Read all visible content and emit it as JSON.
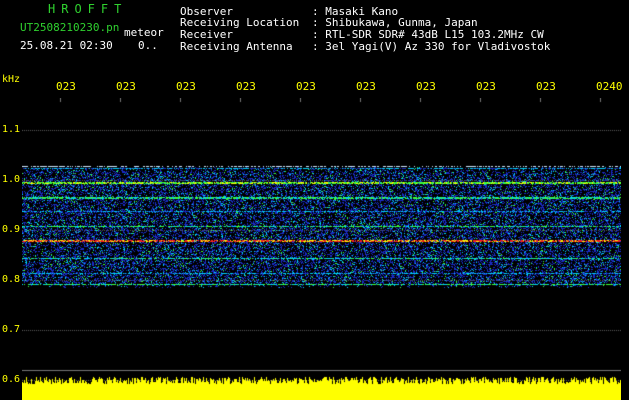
{
  "header": {
    "brand": "HROFFT",
    "filename": "UT2508210230.pn",
    "type": "meteor",
    "date_time": "25.08.21 02:30",
    "counter": "0..",
    "fields": [
      {
        "key": "Observer",
        "value": ": Masaki Kano"
      },
      {
        "key": "Receiving Location",
        "value": ": Shibukawa, Gunma, Japan"
      },
      {
        "key": "Receiver",
        "value": ": RTL-SDR SDR# 43dB L15 103.2MHz CW"
      },
      {
        "key": "Receiving Antenna",
        "value": ": 3el Yagi(V) Az 330 for Vladivostok"
      }
    ]
  },
  "axis": {
    "unit": "kHz",
    "time_ticks": [
      "023",
      "023",
      "023",
      "023",
      "023",
      "023",
      "023",
      "023",
      "023",
      "0240"
    ],
    "freq_ticks": [
      "1.1",
      "1.0",
      "0.9",
      "0.8",
      "0.7",
      "0.6"
    ]
  },
  "colors": {
    "text": "#ffffff",
    "axis": "#ffff00",
    "brand": "#2fd12f",
    "background": "#000000",
    "signal": [
      "#1a2cc8",
      "#00d4ff",
      "#3cff3c",
      "#ffff00",
      "#ff2020"
    ]
  }
}
